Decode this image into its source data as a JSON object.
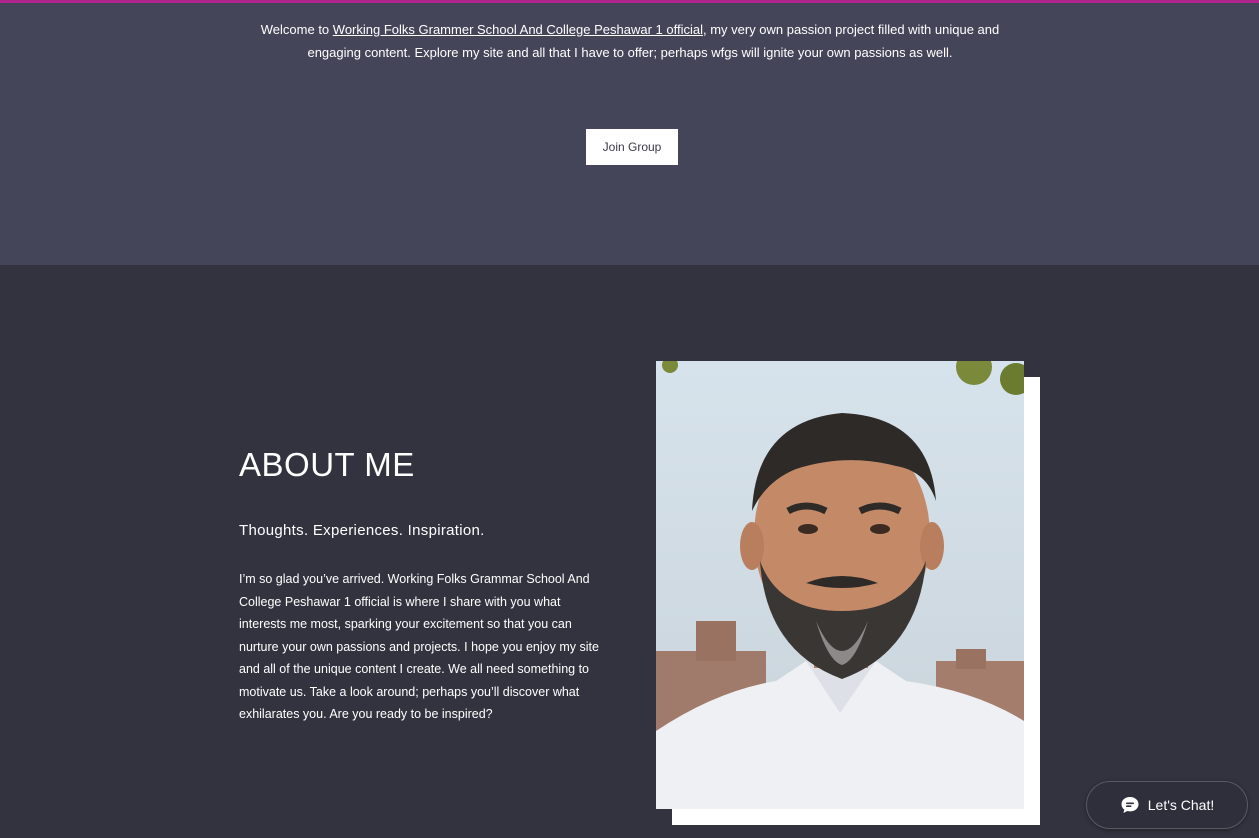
{
  "hero": {
    "welcome_prefix": "Welcome to ",
    "welcome_link": "Working Folks Grammer School And College Peshawar 1 official",
    "welcome_suffix": ", my very own passion project filled with unique and engaging content. Explore my site and all that I have to offer; perhaps wfgs will ignite your own passions as well.",
    "join_button": "Join Group"
  },
  "about": {
    "title": "ABOUT ME",
    "subtitle": "Thoughts. Experiences. Inspiration.",
    "body": "I’m so glad you’ve arrived. Working Folks Grammar School And College Peshawar 1 official is where I share with you what interests me most, sparking your excitement so that you can nurture your own passions and projects. I hope you enjoy my site and all of the unique content I create. We all need something to motivate us. Take a look around; perhaps you’ll discover what exhilarates you. Are you ready to be inspired?"
  },
  "chat": {
    "label": "Let's Chat!",
    "icon": "chat-bubble-icon"
  },
  "colors": {
    "accent": "#b0248e",
    "hero_bg": "#454559",
    "about_bg": "#33333f"
  }
}
